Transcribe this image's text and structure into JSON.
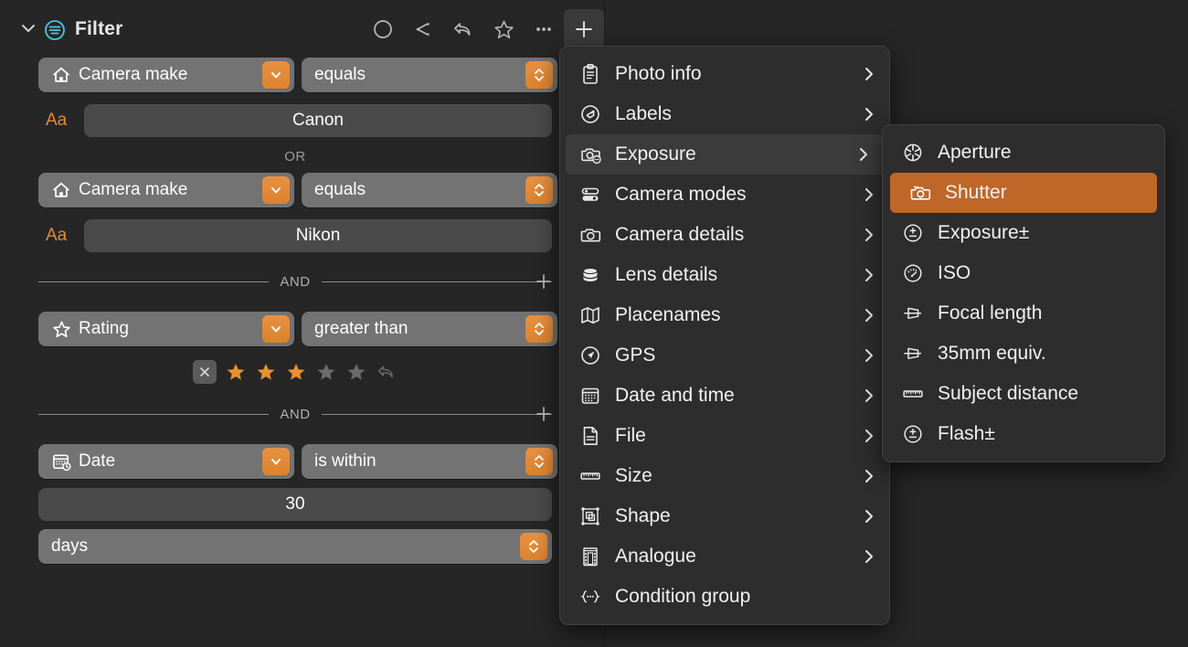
{
  "panel": {
    "title": "Filter",
    "collapse_icon": "chevron-down-icon",
    "badge_icon": "filter-circle-icon",
    "tools": [
      {
        "name": "circle-icon",
        "label": "Circle"
      },
      {
        "name": "share-icon",
        "label": "Share"
      },
      {
        "name": "undo-arrow-icon",
        "label": "Undo"
      },
      {
        "name": "star-outline-icon",
        "label": "Star"
      },
      {
        "name": "ellipsis-icon",
        "label": "More"
      },
      {
        "name": "plus-icon",
        "label": "Add",
        "active": true
      }
    ]
  },
  "conditions": [
    {
      "field_icon": "home-icon",
      "field": "Camera make",
      "operator": "equals",
      "value_icon": "Aa",
      "value": "Canon"
    },
    {
      "field_icon": "home-icon",
      "field": "Camera make",
      "operator": "equals",
      "value_icon": "Aa",
      "value": "Nikon"
    },
    {
      "field_icon": "star-outline-icon",
      "field": "Rating",
      "operator": "greater than",
      "rating": {
        "value": 3,
        "max": 5,
        "clear_label": "×"
      }
    },
    {
      "field_icon": "calendar-clock-icon",
      "field": "Date",
      "operator": "is within",
      "value": "30",
      "unit": "days"
    }
  ],
  "separators": {
    "or": "OR",
    "and": "AND",
    "add_icon": "plus-icon"
  },
  "menu_primary": {
    "items": [
      {
        "icon": "clipboard-icon",
        "label": "Photo info",
        "submenu": true
      },
      {
        "icon": "tag-circle-icon",
        "label": "Labels",
        "submenu": true
      },
      {
        "icon": "camera-dots-icon",
        "label": "Exposure",
        "submenu": true,
        "hovered": true
      },
      {
        "icon": "sliders-icon",
        "label": "Camera modes",
        "submenu": true
      },
      {
        "icon": "camera-icon",
        "label": "Camera details",
        "submenu": true
      },
      {
        "icon": "lens-cylinder-icon",
        "label": "Lens details",
        "submenu": true
      },
      {
        "icon": "map-icon",
        "label": "Placenames",
        "submenu": true
      },
      {
        "icon": "compass-icon",
        "label": "GPS",
        "submenu": true
      },
      {
        "icon": "calendar-icon",
        "label": "Date and time",
        "submenu": true
      },
      {
        "icon": "document-icon",
        "label": "File",
        "submenu": true
      },
      {
        "icon": "ruler-icon",
        "label": "Size",
        "submenu": true
      },
      {
        "icon": "shape-frame-icon",
        "label": "Shape",
        "submenu": true
      },
      {
        "icon": "film-icon",
        "label": "Analogue",
        "submenu": true
      },
      {
        "icon": "braces-icon",
        "label": "Condition group",
        "submenu": false
      }
    ]
  },
  "menu_sub": {
    "items": [
      {
        "icon": "aperture-icon",
        "label": "Aperture",
        "selected": false
      },
      {
        "icon": "shutter-camera-icon",
        "label": "Shutter",
        "selected": true
      },
      {
        "icon": "plusminus-circle-icon",
        "label": "Exposure±",
        "selected": false
      },
      {
        "icon": "iso-gauge-icon",
        "label": "ISO",
        "selected": false
      },
      {
        "icon": "focal-length-icon",
        "label": "Focal length",
        "selected": false
      },
      {
        "icon": "focal-length-icon",
        "label": "35mm equiv.",
        "selected": false
      },
      {
        "icon": "ruler-icon",
        "label": "Subject distance",
        "selected": false
      },
      {
        "icon": "plusminus-circle-icon",
        "label": "Flash±",
        "selected": false
      }
    ]
  },
  "colors": {
    "background": "#262626",
    "menu_background": "#2d2d2d",
    "accent_orange": "#e08b3c",
    "selected_orange": "#bf6729",
    "pill_gray": "#737373",
    "field_gray": "#4a4a4a",
    "filter_badge_cyan": "#4ec3e0",
    "star_gold": "#e8912f"
  }
}
